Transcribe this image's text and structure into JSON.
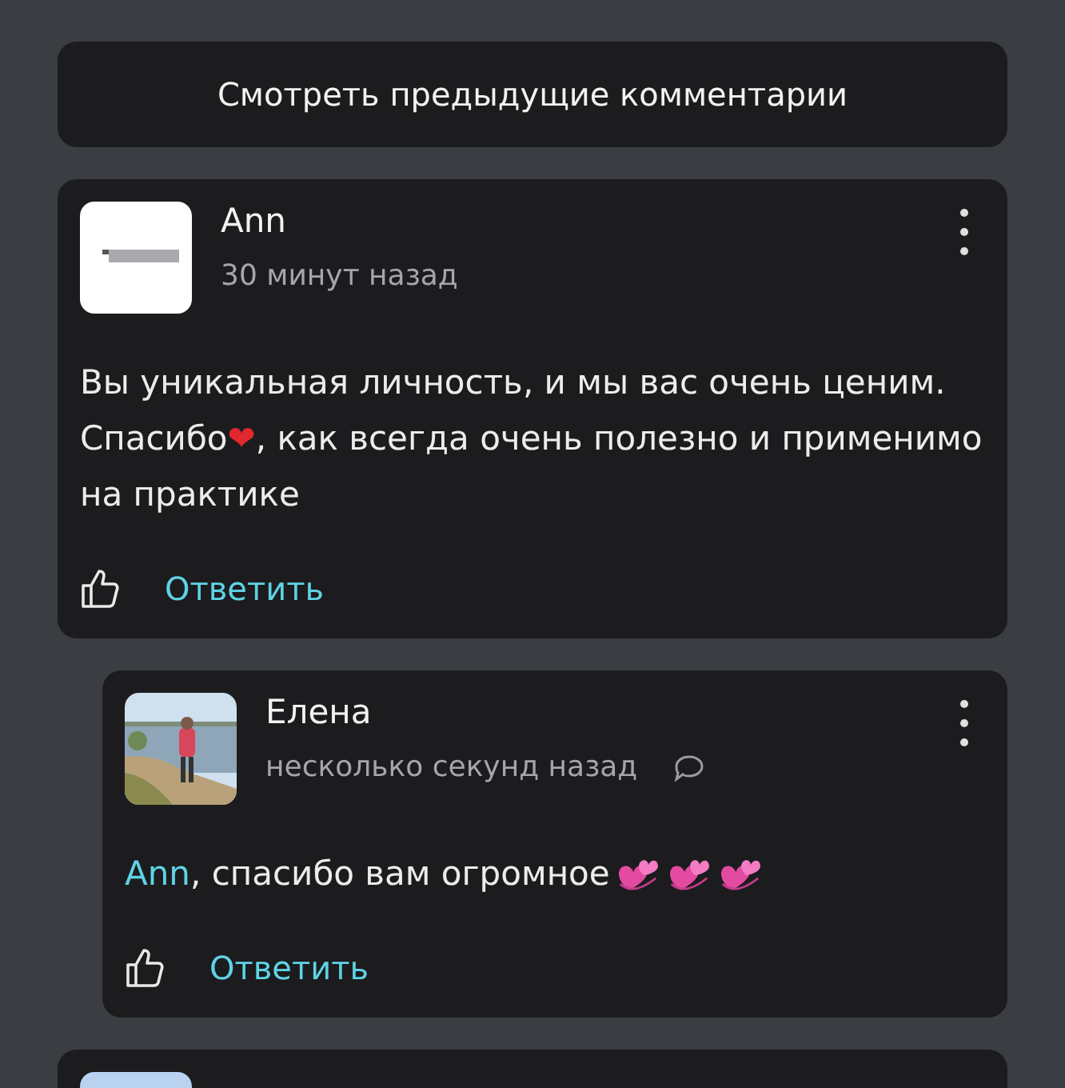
{
  "load_more": {
    "label": "Смотреть предыдущие комментарии"
  },
  "comments": [
    {
      "author": "Ann",
      "time": "30 минут назад",
      "avatar": {
        "kind": "logo"
      },
      "nested": false,
      "reply_icon": false,
      "action": "Ответить",
      "body": [
        {
          "kind": "text",
          "text": "Вы уникальная личность, и мы вас очень ценим. Спасибо"
        },
        {
          "kind": "emoji",
          "text": "❤"
        },
        {
          "kind": "text",
          "text": ", как всегда очень полезно и применимо на практике"
        }
      ]
    },
    {
      "author": "Елена",
      "time": "несколько секунд назад",
      "nested": true,
      "reply_icon": true,
      "action": "Ответить",
      "body": [
        {
          "kind": "mention",
          "text": "Ann"
        },
        {
          "kind": "text",
          "text": ", спасибо вам огромное"
        },
        {
          "kind": "hearts"
        },
        {
          "kind": "hearts"
        },
        {
          "kind": "hearts"
        }
      ]
    },
    {
      "avatar": {
        "kind": "sky"
      },
      "nested": false
    }
  ]
}
